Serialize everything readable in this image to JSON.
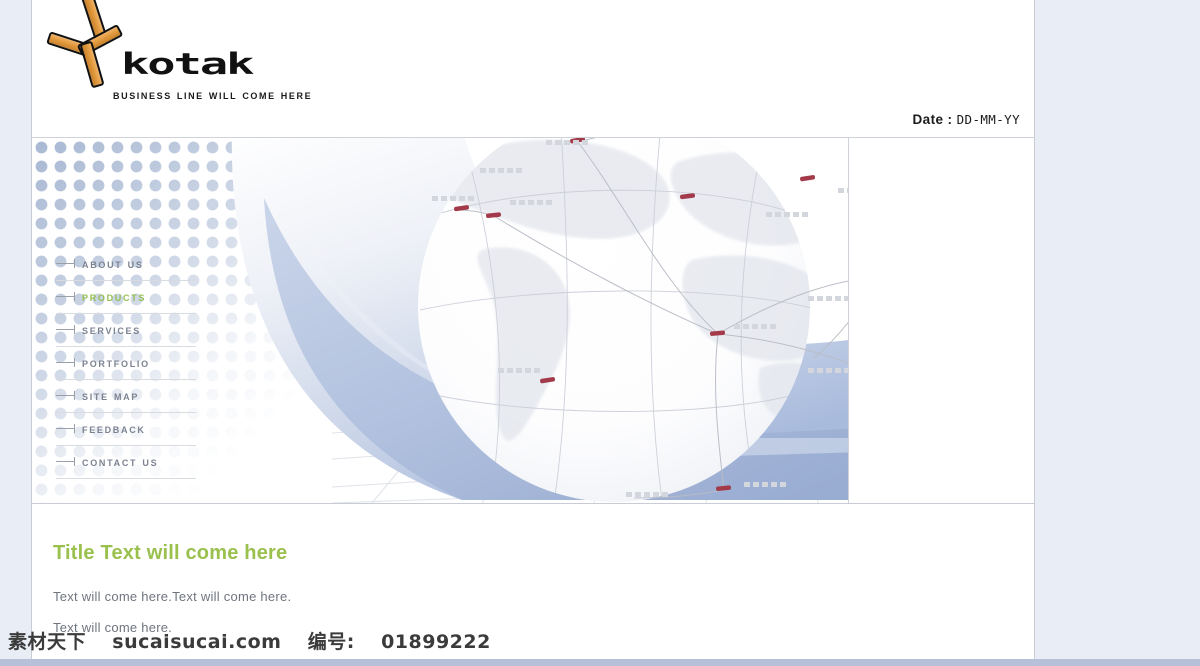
{
  "header": {
    "logo_wordmark": "kotak",
    "logo_tagline": "Business Line will come here",
    "date_label": "Date :",
    "date_value": "DD-MM-YY"
  },
  "nav": {
    "items": [
      {
        "label": "About Us",
        "active": false
      },
      {
        "label": "Products",
        "active": true
      },
      {
        "label": "Services",
        "active": false
      },
      {
        "label": "Portfolio",
        "active": false
      },
      {
        "label": "Site Map",
        "active": false
      },
      {
        "label": "Feedback",
        "active": false
      },
      {
        "label": "Contact Us",
        "active": false
      }
    ]
  },
  "content": {
    "title": "Title Text will come here",
    "line1": "Text will come here.Text will come here.",
    "line2": "Text will come here."
  },
  "watermark": {
    "site_cn": "素材天下",
    "site_url": "sucaisucai.com",
    "id_label": "编号:",
    "id_value": "01899222"
  },
  "colors": {
    "accent_green": "#9ac04e",
    "nav_gray": "#7b8290",
    "logo_orange": "#e39b3f",
    "page_bg": "#ffffff",
    "outer_bg": "#e9eef6",
    "swoosh_blue": "#aab9d6",
    "marker_red": "#a33a4a"
  },
  "hero": {
    "graphic": "world-globe-network",
    "marker_count": 11,
    "placeholder_label_count": 12
  }
}
